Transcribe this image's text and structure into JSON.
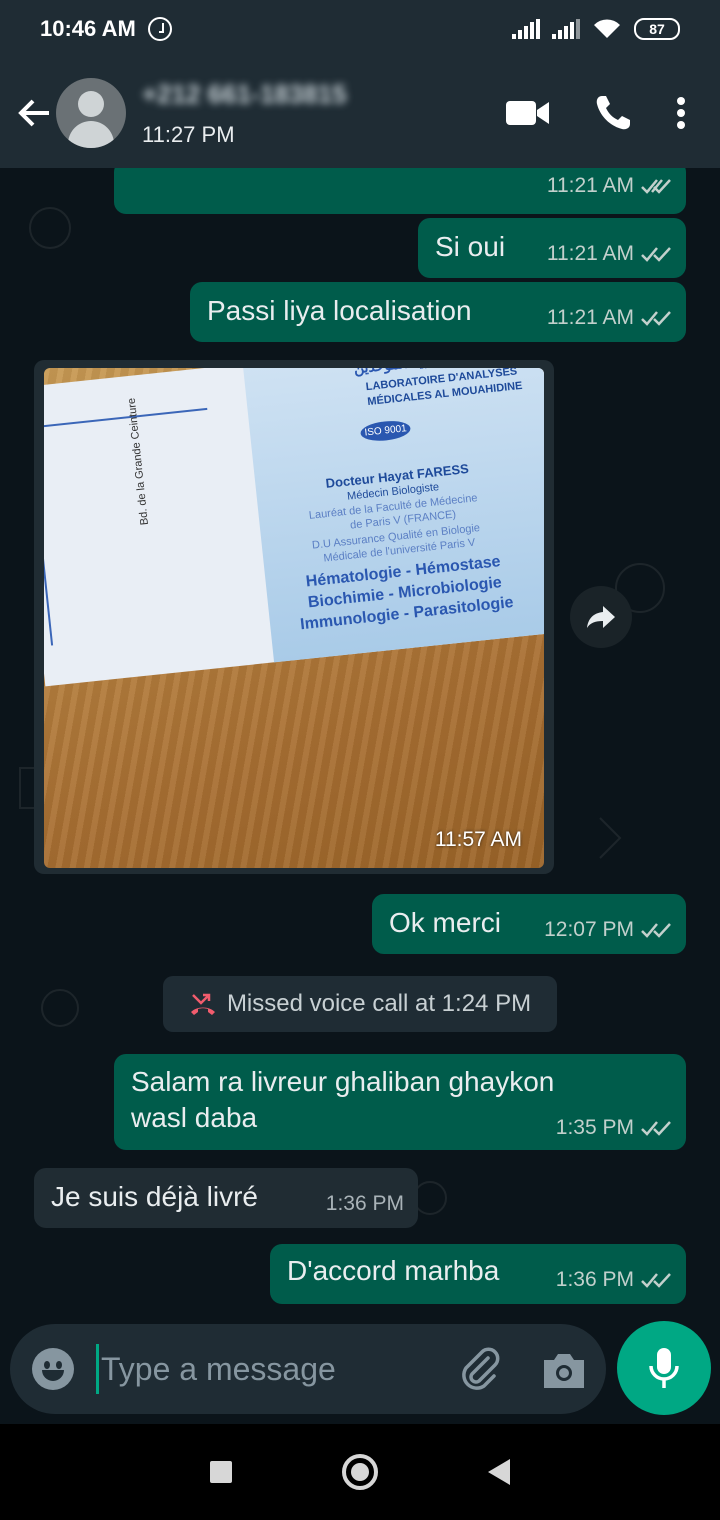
{
  "status_bar": {
    "time": "10:46 AM",
    "battery": "87"
  },
  "header": {
    "contact": "+212 661-183815",
    "subtitle": "11:27 PM"
  },
  "messages": [
    {
      "text": "",
      "time": "11:21 AM"
    },
    {
      "text": "Si oui",
      "time": "11:21 AM"
    },
    {
      "text": "Passi liya localisation",
      "time": "11:21 AM"
    },
    {
      "time": "11:57 AM"
    },
    {
      "text": "Ok merci",
      "time": "12:07 PM"
    },
    {
      "text": "Salam ra livreur ghaliban ghaykon",
      "text2": "wasl daba",
      "time": "1:35 PM"
    },
    {
      "text": "Je suis déjà livré",
      "time": "1:36 PM"
    },
    {
      "text": "D'accord marhba",
      "time": "1:36 PM"
    }
  ],
  "photo_card": {
    "arabic": "مختبر التحليلات الطبية الموحدين",
    "lab1": "LABORATOIRE D'ANALYSES",
    "lab2": "MÉDICALES AL MOUAHIDINE",
    "iso": "ISO 9001",
    "doctor": "Docteur Hayat FARESS",
    "role": "Médecin Biologiste",
    "l1": "Lauréat de la Faculté de Médecine",
    "l2": "de Paris V (FRANCE)",
    "l3": "D.U Assurance Qualité en Biologie",
    "l4": "Médicale de l'université Paris V",
    "s1": "Hématologie - Hémostase",
    "s2": "Biochimie - Microbiologie",
    "s3": "Immunologie - Parasitologie",
    "street": "Bd. de la Grande Ceinture"
  },
  "system_message": "Missed voice call at 1:24 PM",
  "composer": {
    "placeholder": "Type a message"
  },
  "colors": {
    "outgoing": "#005c4b",
    "incoming": "#202c33",
    "accent": "#00a884",
    "background": "#0b141a"
  }
}
